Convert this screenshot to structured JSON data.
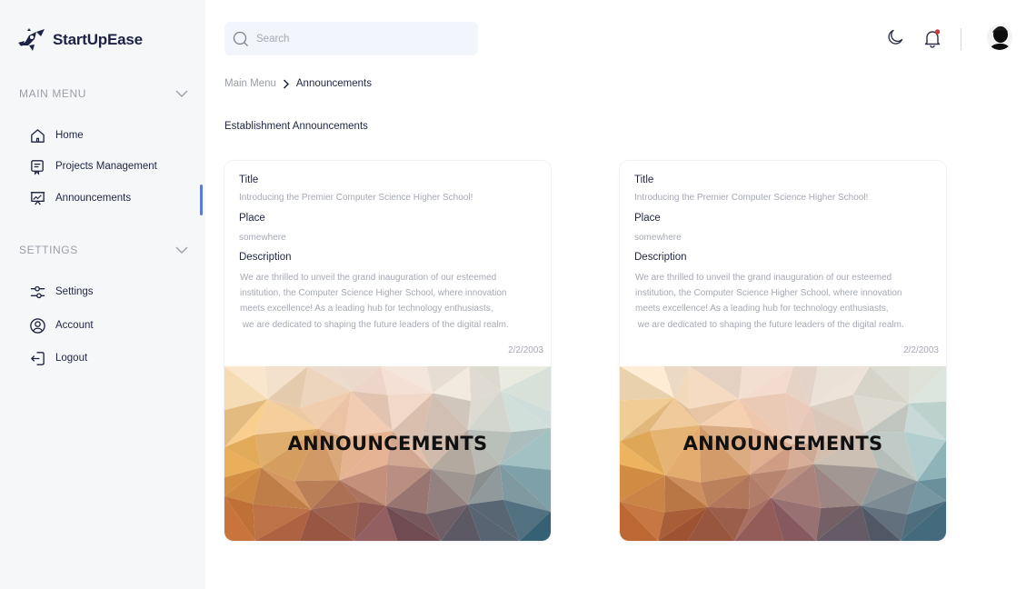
{
  "app": {
    "name": "StartUpEase"
  },
  "sidebar": {
    "main_menu": {
      "title": "MAIN MENU",
      "items": [
        {
          "label": "Home",
          "icon": "home-icon"
        },
        {
          "label": "Projects Management",
          "icon": "clipboard-icon"
        },
        {
          "label": "Announcements",
          "icon": "presentation-icon",
          "active": true
        }
      ]
    },
    "settings": {
      "title": "SETTINGS",
      "items": [
        {
          "label": "Settings",
          "icon": "sliders-icon"
        },
        {
          "label": "Account",
          "icon": "user-circle-icon"
        },
        {
          "label": "Logout",
          "icon": "logout-icon"
        }
      ]
    }
  },
  "header": {
    "search": {
      "placeholder": "Search",
      "value": ""
    },
    "icons": [
      "moon-icon",
      "bell-icon",
      "avatar"
    ],
    "notification_dot_color": "#d13a3a"
  },
  "breadcrumb": {
    "root": "Main Menu",
    "current": "Announcements"
  },
  "page": {
    "title": "Establishment Announcements"
  },
  "cards": [
    {
      "title_label": "Title",
      "title_value": "Introducing the Premier Computer Science Higher School!",
      "place_label": "Place",
      "place_value": "somewhere",
      "description_label": "Description",
      "description_lines": [
        "We are thrilled to unveil the grand inauguration of our esteemed",
        "institution, the Computer Science Higher School, where innovation",
        "meets excellence! As a leading hub for technology enthusiasts,",
        " we are dedicated to shaping the future leaders of the digital realm."
      ],
      "date": "2/2/2003",
      "banner_text": "ANNOUNCEMENTS"
    },
    {
      "title_label": "Title",
      "title_value": "Introducing the Premier Computer Science Higher School!",
      "place_label": "Place",
      "place_value": "somewhere",
      "description_label": "Description",
      "description_lines": [
        "We are thrilled to unveil the grand inauguration of our esteemed",
        "institution, the Computer Science Higher School, where innovation",
        "meets excellence! As a leading hub for technology enthusiasts,",
        " we are dedicated to shaping the future leaders of the digital realm."
      ],
      "date": "2/2/2003",
      "banner_text": "ANNOUNCEMENTS"
    }
  ],
  "colors": {
    "sidebar_bg": "#f6f7f9",
    "accent": "#5b7bd9",
    "text": "#1f2541",
    "muted": "#a5a9b3",
    "search_bg": "#f2f5fc"
  }
}
